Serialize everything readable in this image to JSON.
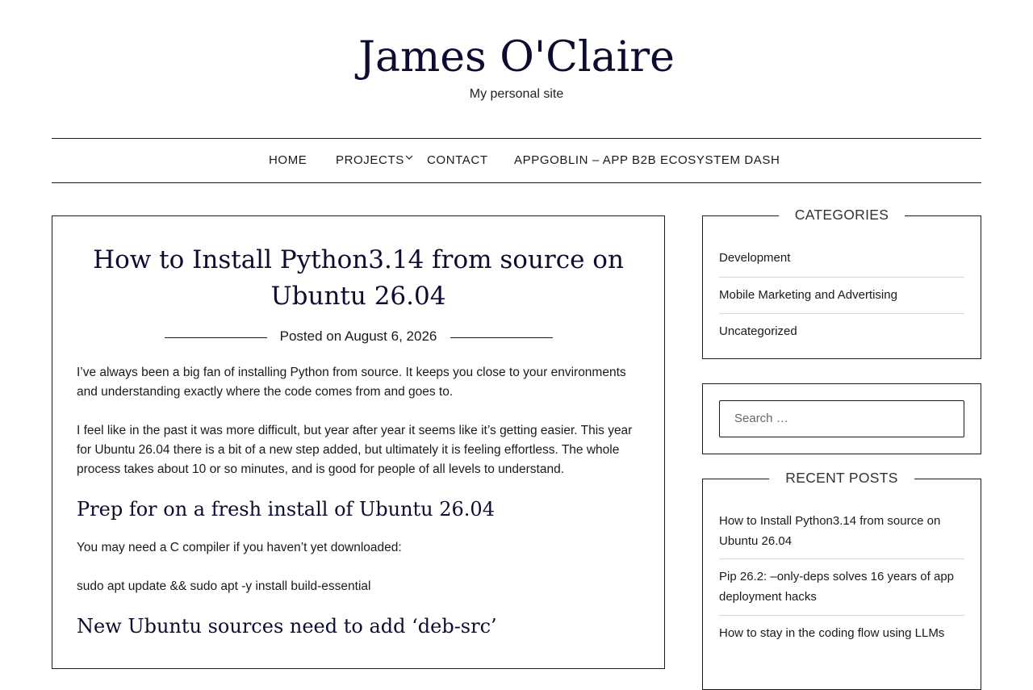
{
  "site": {
    "title": "James O'Claire",
    "description": "My personal site"
  },
  "nav": {
    "items": [
      {
        "label": "HOME"
      },
      {
        "label": "PROJECTS"
      },
      {
        "label": "CONTACT"
      },
      {
        "label": "APPGOBLIN – APP B2B ECOSYSTEM DASH"
      }
    ]
  },
  "post": {
    "title": "How to Install Python3.14 from source on Ubuntu 26.04",
    "posted_prefix": "Posted on ",
    "date": "August 6, 2026",
    "paragraphs": [
      "I’ve always been a big fan of installing Python from source. It keeps you close to your environments and understanding exactly where the code comes from and goes to.",
      "I feel like in the past it was more difficult, but year after year it seems like it’s getting easier. This year for Ubuntu 26.04 there is a bit of a new step added, but ultimately it is feeling effortless. The whole process takes about 10 or so minutes, and is good for people of all levels to understand."
    ],
    "heading1": "Prep for on a fresh install of Ubuntu 26.04",
    "paragraph3": "You may need a C compiler if you haven’t yet downloaded:",
    "command1": "sudo apt update && sudo apt -y install build-essential",
    "heading2": "New Ubuntu sources need to add ‘deb-src’"
  },
  "sidebar": {
    "categories_title": "CATEGORIES",
    "categories": [
      {
        "label": "Development"
      },
      {
        "label": "Mobile Marketing and Advertising"
      },
      {
        "label": "Uncategorized"
      }
    ],
    "search_placeholder": "Search …",
    "recent_title": "RECENT POSTS",
    "recent_posts": [
      {
        "label": "How to Install Python3.14 from source on Ubuntu 26.04"
      },
      {
        "label": "Pip 26.2: –only-deps solves 16 years of app deployment hacks"
      },
      {
        "label": "How to stay in the coding flow using LLMs"
      }
    ]
  }
}
